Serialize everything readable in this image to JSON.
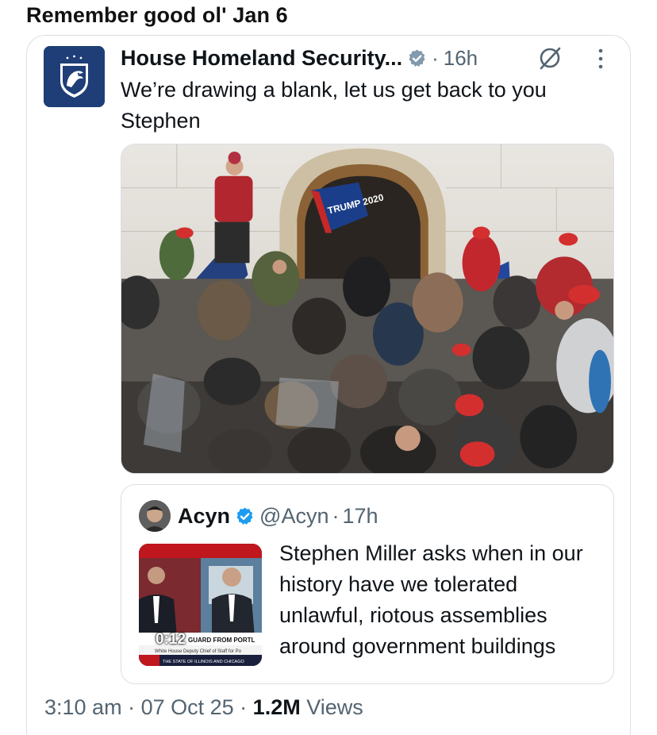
{
  "caption": "Remember good ol' Jan 6",
  "post": {
    "author_name": "House Homeland Security...",
    "verified_icon": "verified-badge-icon",
    "separator": "·",
    "time": "16h",
    "text": "We’re drawing a blank, let us get back to you Stephen",
    "avatar_icon": "eagle-seal-icon",
    "grok_icon": "grok-slash-icon",
    "more_icon": "more-vertical-icon",
    "photo_icon": "crowd-photo",
    "flag_text": "TRUMP 2020"
  },
  "quote": {
    "author_name": "Acyn",
    "handle": "@Acyn",
    "separator": "·",
    "time": "17h",
    "text": "Stephen Miller asks when in our history have we tolerated unlawful, riotous assemblies around government buildings",
    "video_duration": "0:12",
    "thumbnail_caption": "GUARD FROM PORTL",
    "thumbnail_sub": "White House Deputy Chief of Staff for Po",
    "thumbnail_ticker": "THE STATE OF ILLINOIS AND CHICAGO"
  },
  "meta": {
    "time": "3:10 am",
    "separator1": "·",
    "date": "07 Oct 25",
    "separator2": "·",
    "views_count": "1.2M",
    "views_label": "Views"
  },
  "colors": {
    "text_primary": "#0f1419",
    "text_secondary": "#536471",
    "verified_blue": "#1d9bf0",
    "verified_gray": "#829aab",
    "border": "#d9dfe4",
    "avatar_navy": "#1f3d77"
  }
}
